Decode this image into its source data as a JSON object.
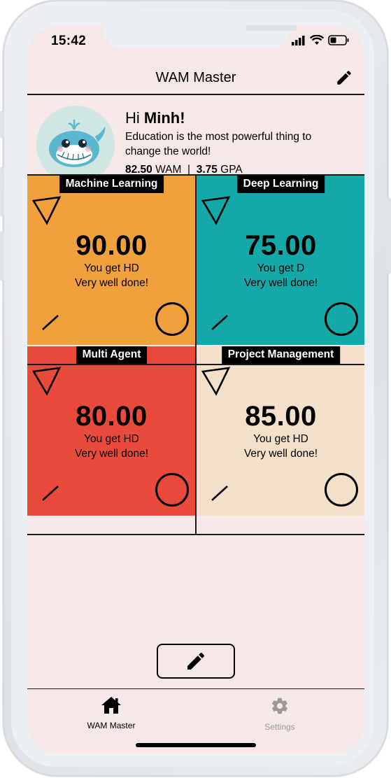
{
  "status_bar": {
    "time": "15:42"
  },
  "header": {
    "title": "WAM Master"
  },
  "profile": {
    "greeting_prefix": "Hi ",
    "name": "Minh!",
    "motto": "Education is the most powerful thing to change the world!",
    "wam_value": "82.50",
    "wam_label": " WAM",
    "separator": "|",
    "gpa_value": "3.75",
    "gpa_label": " GPA"
  },
  "subjects": [
    {
      "label": "Machine Learning",
      "score": "90.00",
      "grade": "You get HD",
      "message": "Very well done!",
      "color": "#f0a03c"
    },
    {
      "label": "Deep Learning",
      "score": "75.00",
      "grade": "You get D",
      "message": "Very well done!",
      "color": "#14a8a8"
    },
    {
      "label": "Multi Agent",
      "score": "80.00",
      "grade": "You get HD",
      "message": "Very well done!",
      "color": "#e84b3c"
    },
    {
      "label": "Project Management",
      "score": "85.00",
      "grade": "You get HD",
      "message": "Very well done!",
      "color": "#f3e0cb"
    }
  ],
  "tabs": [
    {
      "label": "WAM Master",
      "icon": "home-icon",
      "active": true
    },
    {
      "label": "Settings",
      "icon": "gear-icon",
      "active": false
    }
  ],
  "colors": {
    "background": "#f5e8e6",
    "inactive_tab": "#999999"
  }
}
